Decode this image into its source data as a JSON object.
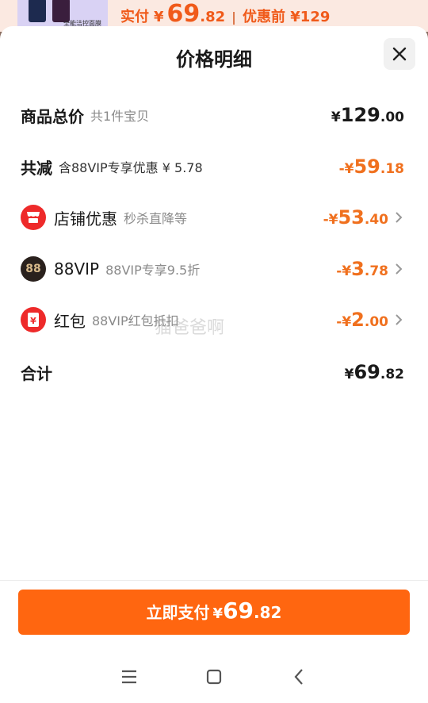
{
  "peek": {
    "thumb_text": "全能洁控面膜",
    "price_label": "实付",
    "yen": "¥",
    "price_int": "69",
    "price_dec": ".82",
    "separator": "|",
    "original_label": "优惠前 ¥129"
  },
  "sheet": {
    "title": "价格明细",
    "close_icon": "close-icon"
  },
  "rows": {
    "total": {
      "label": "商品总价",
      "sub": "共1件宝贝",
      "yen": "¥",
      "int": "129",
      "dec": ".00"
    },
    "reduction": {
      "label": "共减",
      "sub": "含88VIP专享优惠 ¥ 5.78",
      "sign": "-¥",
      "int": "59",
      "dec": ".18"
    },
    "store": {
      "icon": "store-icon",
      "label": "店铺优惠",
      "sub": "秒杀直降等",
      "sign": "-¥",
      "int": "53",
      "dec": ".40"
    },
    "vip": {
      "icon": "88vip-icon",
      "icon_text": "88",
      "label": "88VIP",
      "sub": "88VIP专享9.5折",
      "sign": "-¥",
      "int": "3",
      "dec": ".78"
    },
    "redpacket": {
      "icon": "red-packet-icon",
      "label": "红包",
      "sub": "88VIP红包抵扣",
      "sign": "-¥",
      "int": "2",
      "dec": ".00"
    },
    "sum": {
      "label": "合计",
      "yen": "¥",
      "int": "69",
      "dec": ".82"
    }
  },
  "watermark": "猫爸爸啊",
  "pay_button": {
    "label": "立即支付",
    "yen": "¥",
    "int": "69",
    "dec": ".82"
  },
  "colors": {
    "accent": "#ff6610",
    "discount": "#f0701e",
    "store_red": "#ee2a2a"
  },
  "navbar": {
    "menu_icon": "menu-icon",
    "home_icon": "home-icon",
    "back_icon": "back-icon"
  }
}
